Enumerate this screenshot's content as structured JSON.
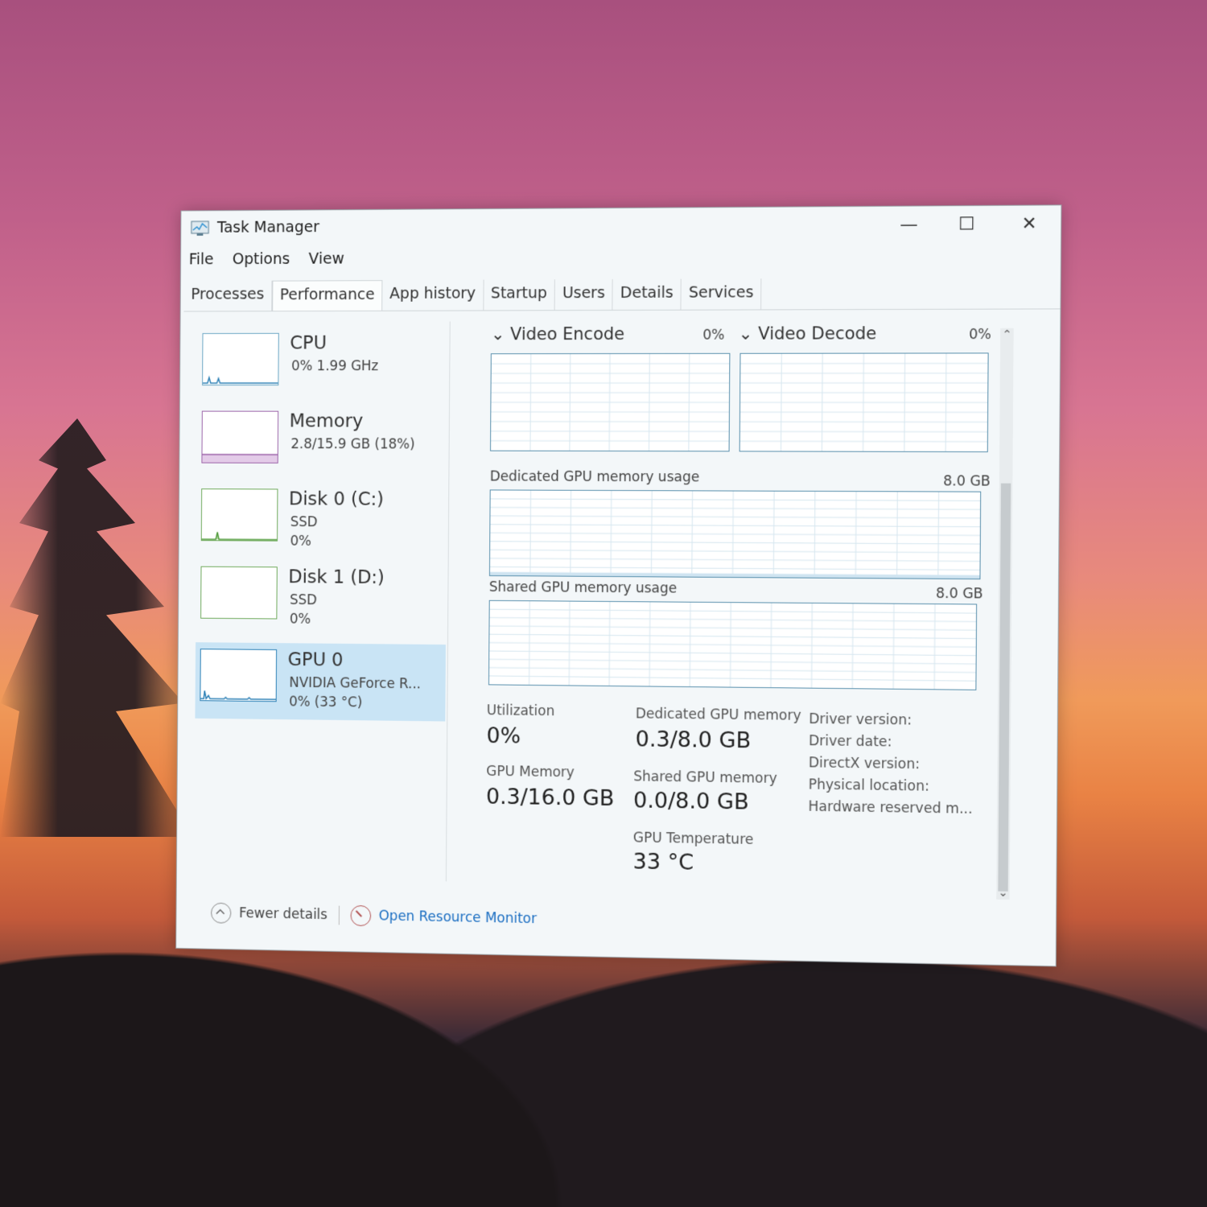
{
  "window": {
    "title": "Task Manager",
    "controls": {
      "minimize": "—",
      "maximize": "☐",
      "close": "✕"
    }
  },
  "menu": [
    "File",
    "Options",
    "View"
  ],
  "tabs": [
    "Processes",
    "Performance",
    "App history",
    "Startup",
    "Users",
    "Details",
    "Services"
  ],
  "active_tab": "Performance",
  "sidebar": {
    "items": [
      {
        "name": "CPU",
        "line1": "0%  1.99 GHz",
        "line2": ""
      },
      {
        "name": "Memory",
        "line1": "2.8/15.9 GB (18%)",
        "line2": ""
      },
      {
        "name": "Disk 0 (C:)",
        "line1": "SSD",
        "line2": "0%"
      },
      {
        "name": "Disk 1 (D:)",
        "line1": "SSD",
        "line2": "0%"
      },
      {
        "name": "GPU 0",
        "line1": "NVIDIA GeForce R...",
        "line2": "0%  (33 °C)"
      }
    ]
  },
  "graphs": {
    "video_encode": {
      "label": "Video Encode",
      "value": "0%"
    },
    "video_decode": {
      "label": "Video Decode",
      "value": "0%"
    },
    "dedicated": {
      "label": "Dedicated GPU memory usage",
      "max": "8.0 GB"
    },
    "shared": {
      "label": "Shared GPU memory usage",
      "max": "8.0 GB"
    }
  },
  "stats": {
    "utilization": {
      "label": "Utilization",
      "value": "0%"
    },
    "dedicated_mem": {
      "label": "Dedicated GPU memory",
      "value": "0.3/8.0 GB"
    },
    "gpu_memory": {
      "label": "GPU Memory",
      "value": "0.3/16.0 GB"
    },
    "shared_mem": {
      "label": "Shared GPU memory",
      "value": "0.0/8.0 GB"
    },
    "gpu_temp": {
      "label": "GPU Temperature",
      "value": "33 °C"
    }
  },
  "info_labels": [
    "Driver version:",
    "Driver date:",
    "DirectX version:",
    "Physical location:",
    "Hardware reserved m..."
  ],
  "footer": {
    "fewer_details": "Fewer details",
    "resource_monitor": "Open Resource Monitor"
  }
}
